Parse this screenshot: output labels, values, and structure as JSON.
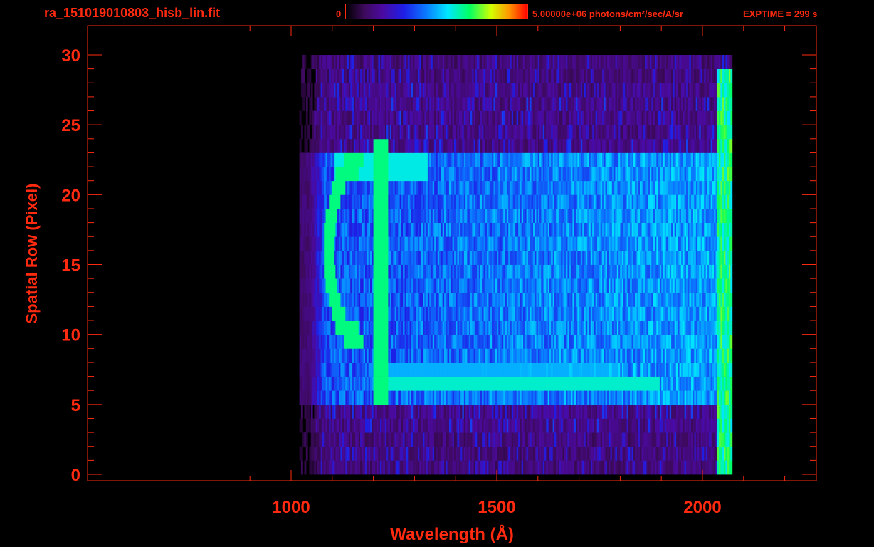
{
  "header": {
    "filename": "ra_151019010803_hisb_lin.fit",
    "colorbar_min": "0",
    "colorbar_max": "5.00000e+06 photons/cm²/sec/A/sr",
    "exptime": "EXPTIME = 299 s"
  },
  "colors": {
    "axis": "#ff2a10",
    "background": "#000000"
  },
  "chart_data": {
    "type": "heatmap",
    "xlabel": "Wavelength (Å)",
    "ylabel": "Spatial Row (Pixel)",
    "xlim": [
      900,
      2250
    ],
    "ylim": [
      0,
      30
    ],
    "x_ticks": [
      1000,
      1500,
      2000
    ],
    "y_ticks": [
      0,
      5,
      10,
      15,
      20,
      25,
      30
    ],
    "colormap_range": [
      0,
      5000000
    ],
    "grid": false,
    "features": {
      "bright_vertical_line_wavelength": 1216,
      "bright_horizontal_row": 6,
      "illuminated_rows": [
        5,
        23
      ],
      "data_wavelength_range": [
        1050,
        2070
      ]
    }
  }
}
